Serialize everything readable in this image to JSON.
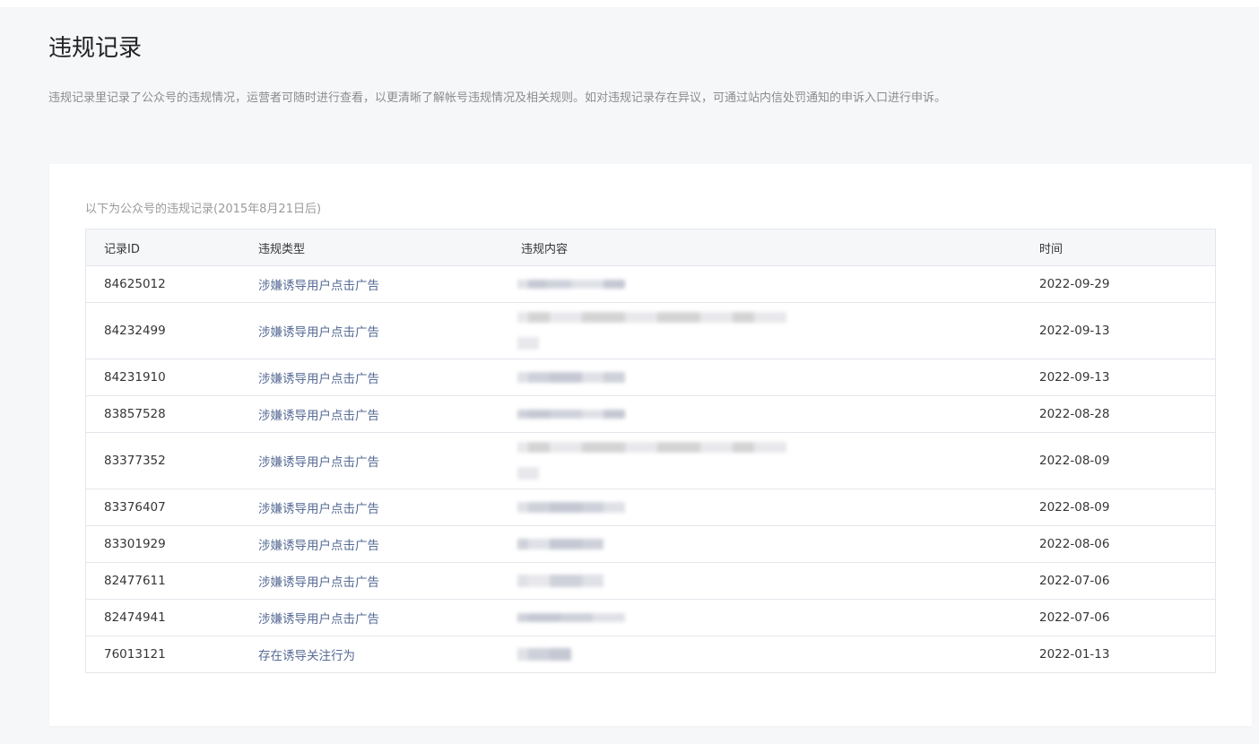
{
  "page": {
    "title": "违规记录",
    "description": "违规记录里记录了公众号的违规情况，运营者可随时进行查看，以更清晰了解帐号违规情况及相关规则。如对违规记录存在异议，可通过站内信处罚通知的申诉入口进行申诉。"
  },
  "table": {
    "caption": "以下为公众号的违规记录(2015年8月21日后)",
    "columns": {
      "id": "记录ID",
      "type": "违规类型",
      "content": "违规内容",
      "time": "时间"
    },
    "rows": [
      {
        "id": "84625012",
        "type": "涉嫌诱导用户点击广告",
        "time": "2022-09-29",
        "tall": false
      },
      {
        "id": "84232499",
        "type": "涉嫌诱导用户点击广告",
        "time": "2022-09-13",
        "tall": true
      },
      {
        "id": "84231910",
        "type": "涉嫌诱导用户点击广告",
        "time": "2022-09-13",
        "tall": false
      },
      {
        "id": "83857528",
        "type": "涉嫌诱导用户点击广告",
        "time": "2022-08-28",
        "tall": false
      },
      {
        "id": "83377352",
        "type": "涉嫌诱导用户点击广告",
        "time": "2022-08-09",
        "tall": true
      },
      {
        "id": "83376407",
        "type": "涉嫌诱导用户点击广告",
        "time": "2022-08-09",
        "tall": false
      },
      {
        "id": "83301929",
        "type": "涉嫌诱导用户点击广告",
        "time": "2022-08-06",
        "tall": false
      },
      {
        "id": "82477611",
        "type": "涉嫌诱导用户点击广告",
        "time": "2022-07-06",
        "tall": false
      },
      {
        "id": "82474941",
        "type": "涉嫌诱导用户点击广告",
        "time": "2022-07-06",
        "tall": false
      },
      {
        "id": "76013121",
        "type": "存在诱导关注行为",
        "time": "2022-01-13",
        "tall": false
      }
    ]
  },
  "colors": {
    "page_bg": "#f6f7f9",
    "card_bg": "#ffffff",
    "link": "#576b95",
    "border": "#e4e6eb",
    "muted_text": "#8c8c8c"
  }
}
